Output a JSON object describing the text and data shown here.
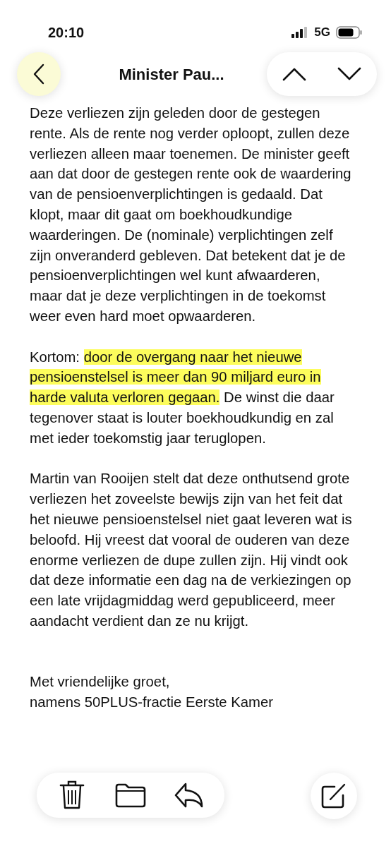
{
  "status_bar": {
    "time": "20:10",
    "network": "5G"
  },
  "nav": {
    "title": "Minister Pau..."
  },
  "body": [
    {
      "segments": [
        {
          "text": "Deze verliezen zijn geleden door de gestegen rente. Als de rente nog verder oploopt, zullen deze verliezen alleen maar toenemen. De minister geeft aan dat door de gestegen rente ook de waardering van de pensioenverplichtingen is gedaald. Dat klopt, maar dit gaat om boekhoudkundige waarderingen. De (nominale) verplichtingen zelf zijn onveranderd gebleven. Dat betekent dat je de pensioenverplichtingen wel kunt afwaarderen, maar dat je deze verplichtingen in de toekomst weer even hard moet opwaarderen.",
          "highlighted": false
        }
      ]
    },
    {
      "segments": [
        {
          "text": "Kortom: ",
          "highlighted": false
        },
        {
          "text": "door de overgang naar het nieuwe pensioenstelsel is meer dan 90 miljard euro in harde valuta verloren gegaan.",
          "highlighted": true
        },
        {
          "text": " De winst die daar tegenover staat is louter boekhoudkundig en zal met ieder toekomstig jaar teruglopen.",
          "highlighted": false
        }
      ]
    },
    {
      "segments": [
        {
          "text": "Martin van Rooijen stelt dat deze onthutsend grote verliezen het zoveelste bewijs zijn van het feit dat het nieuwe pensioenstelsel niet gaat leveren wat is beloofd. Hij vreest dat vooral de ouderen van deze enorme verliezen de dupe zullen zijn. Hij vindt ook dat deze informatie een dag na de verkiezingen op een late vrijdagmiddag werd gepubliceerd, meer aandacht verdient dan ze nu krijgt.",
          "highlighted": false
        }
      ]
    }
  ],
  "signature": [
    "Met vriendelijke groet,",
    "namens 50PLUS-fractie Eerste Kamer"
  ]
}
